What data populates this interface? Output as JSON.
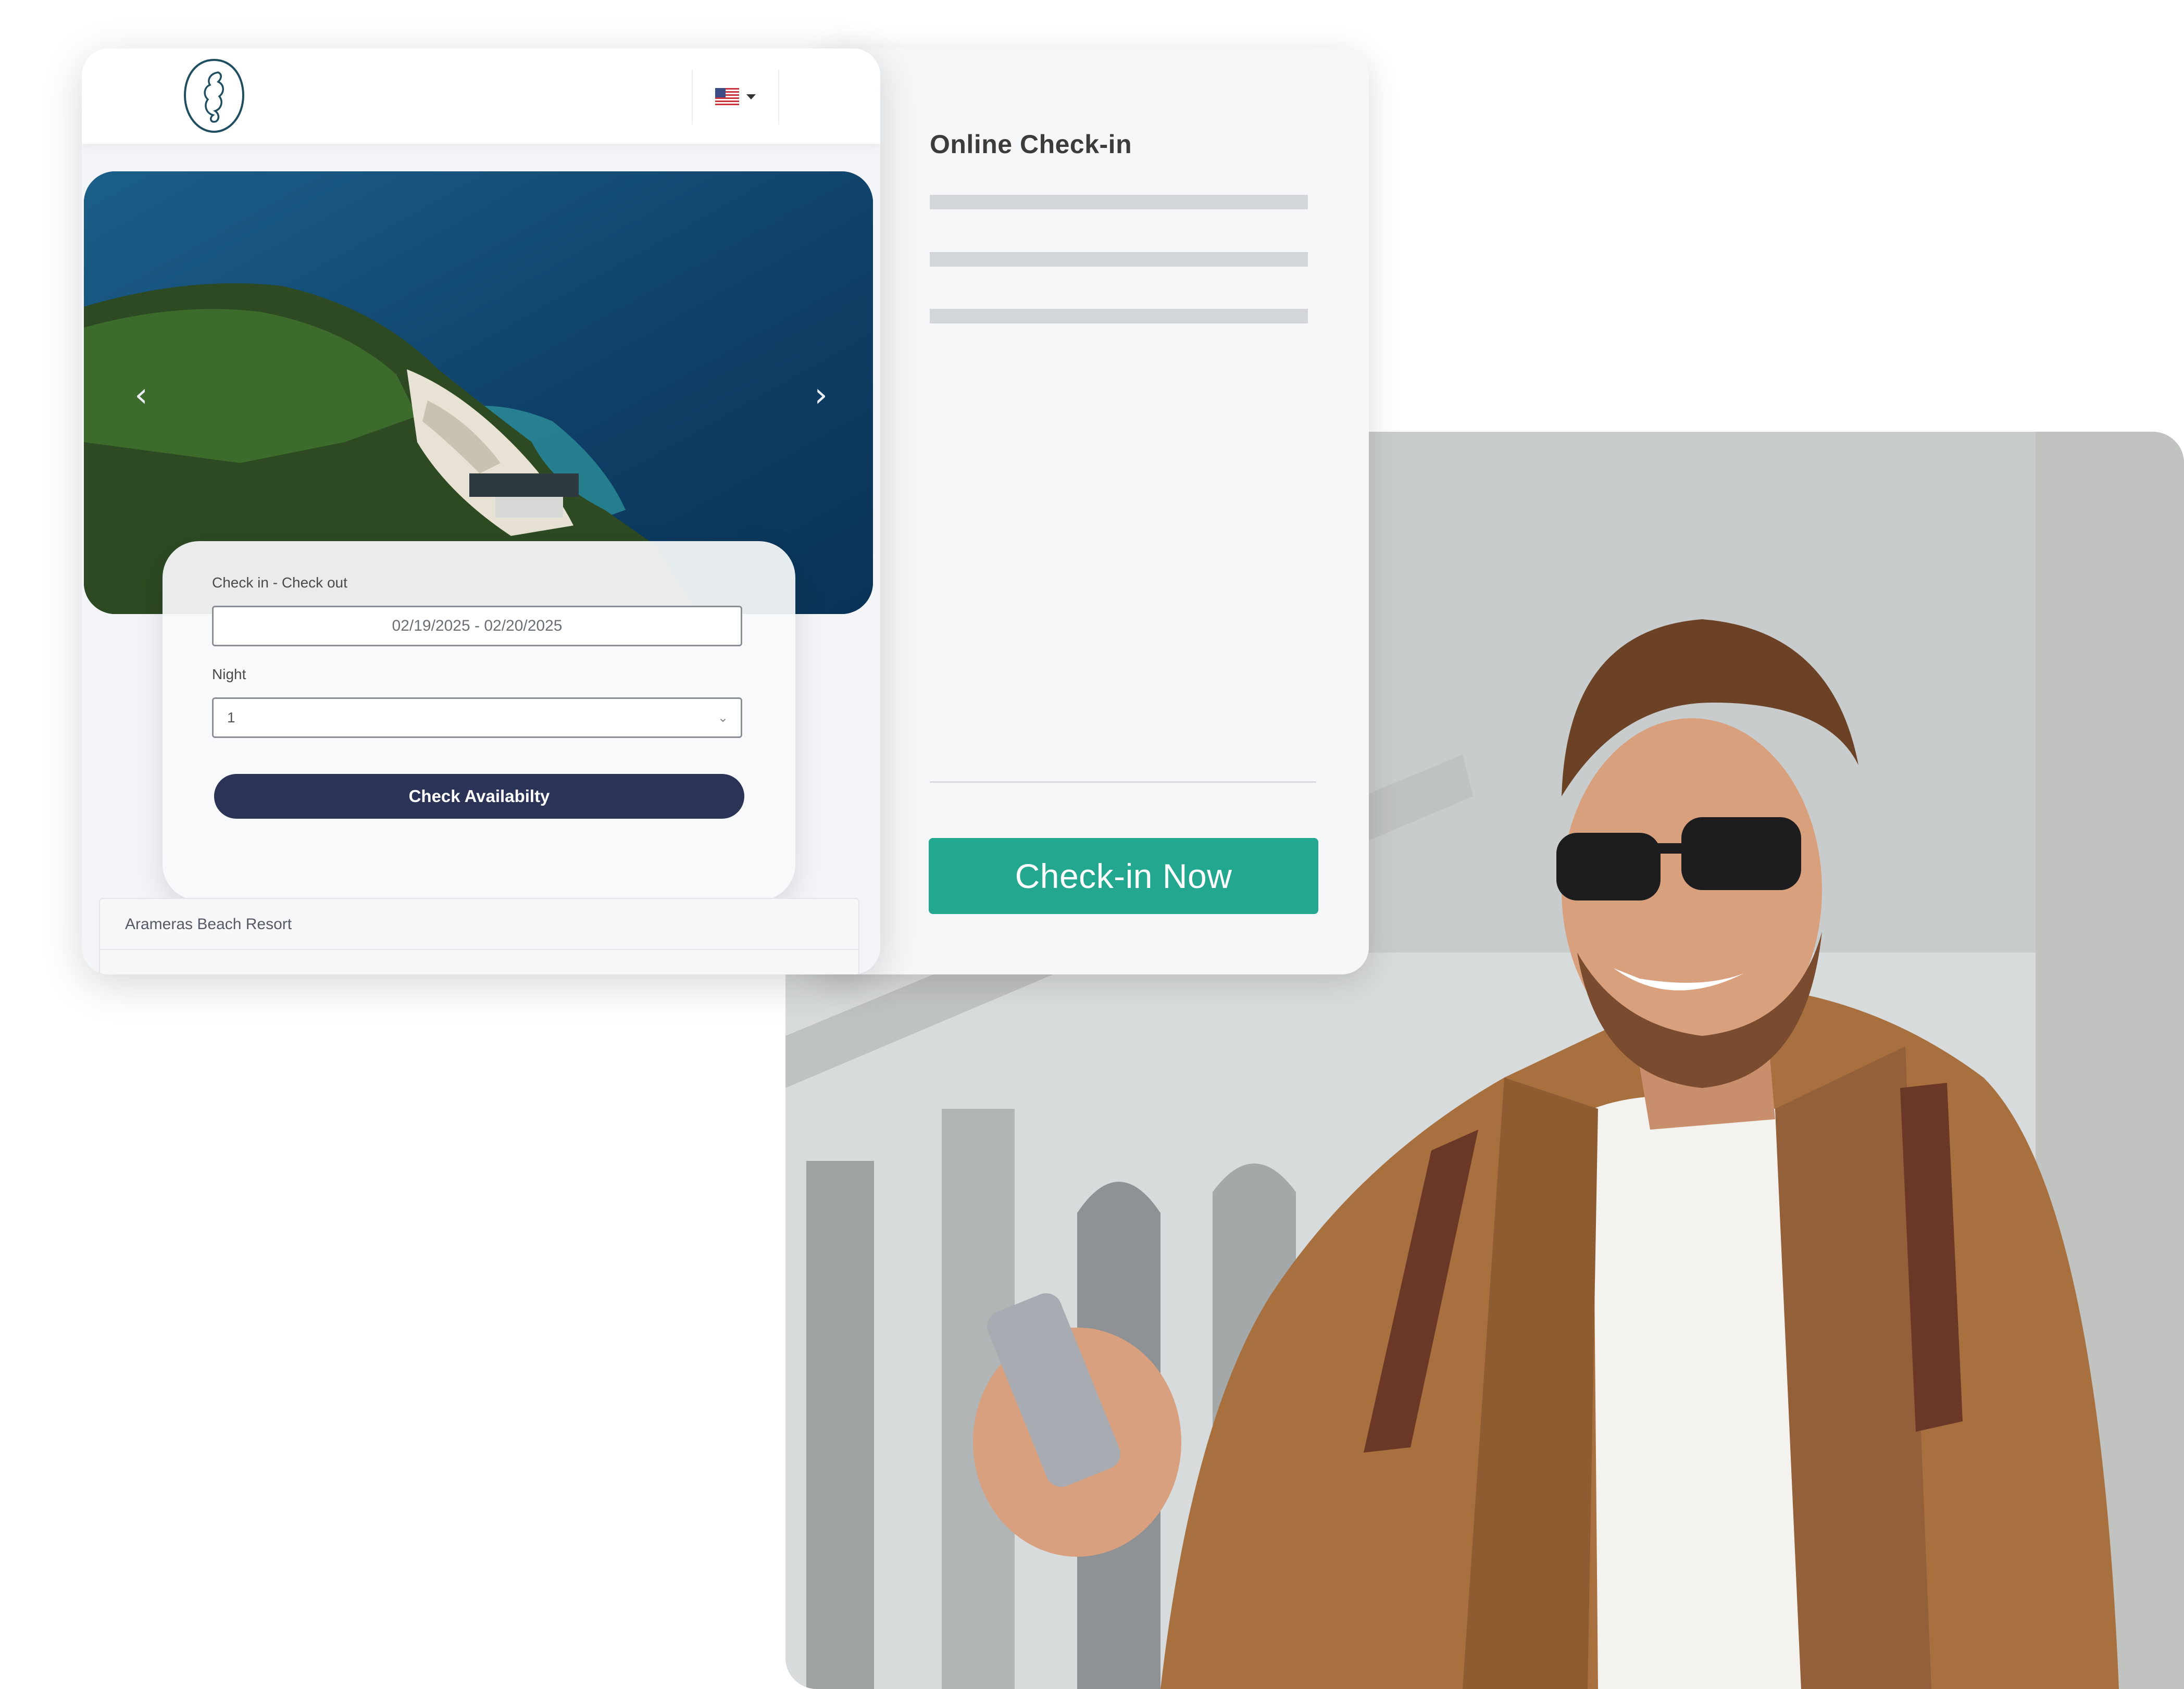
{
  "booking": {
    "language_flag": "us-flag-icon",
    "checkin_label": "Check in - Check out",
    "date_range": "02/19/2025 - 02/20/2025",
    "night_label": "Night",
    "night_value": "1",
    "check_availability_label": "Check Availabilty",
    "resort_name": "Arameras Beach Resort"
  },
  "checkin": {
    "title": "Online Check-in",
    "button_label": "Check-in Now"
  },
  "colors": {
    "accent": "#23a88f",
    "primary_dark": "#2b3456",
    "logo_stroke": "#1e4e5f"
  }
}
